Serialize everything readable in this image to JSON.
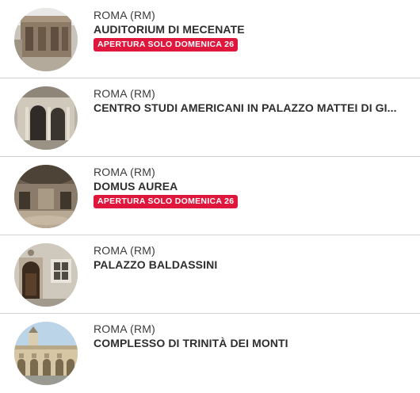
{
  "items": [
    {
      "city": "ROMA (RM)",
      "title": "AUDITORIUM DI MECENATE",
      "badge": "APERTURA SOLO DOMENICA 26",
      "icon": "auditorium-photo"
    },
    {
      "city": "ROMA (RM)",
      "title": "CENTRO STUDI AMERICANI IN PALAZZO MATTEI DI GI...",
      "badge": "",
      "icon": "palazzo-mattei-photo"
    },
    {
      "city": "ROMA (RM)",
      "title": "DOMUS AUREA",
      "badge": "APERTURA SOLO DOMENICA 26",
      "icon": "domus-aurea-photo"
    },
    {
      "city": "ROMA (RM)",
      "title": "PALAZZO BALDASSINI",
      "badge": "",
      "icon": "palazzo-baldassini-photo"
    },
    {
      "city": "ROMA (RM)",
      "title": "COMPLESSO DI TRINITÀ DEI MONTI",
      "badge": "",
      "icon": "trinita-dei-monti-photo"
    }
  ],
  "colors": {
    "badge_bg": "#e0173c",
    "divider": "#d2d2d2",
    "text": "#2e2e2e"
  }
}
